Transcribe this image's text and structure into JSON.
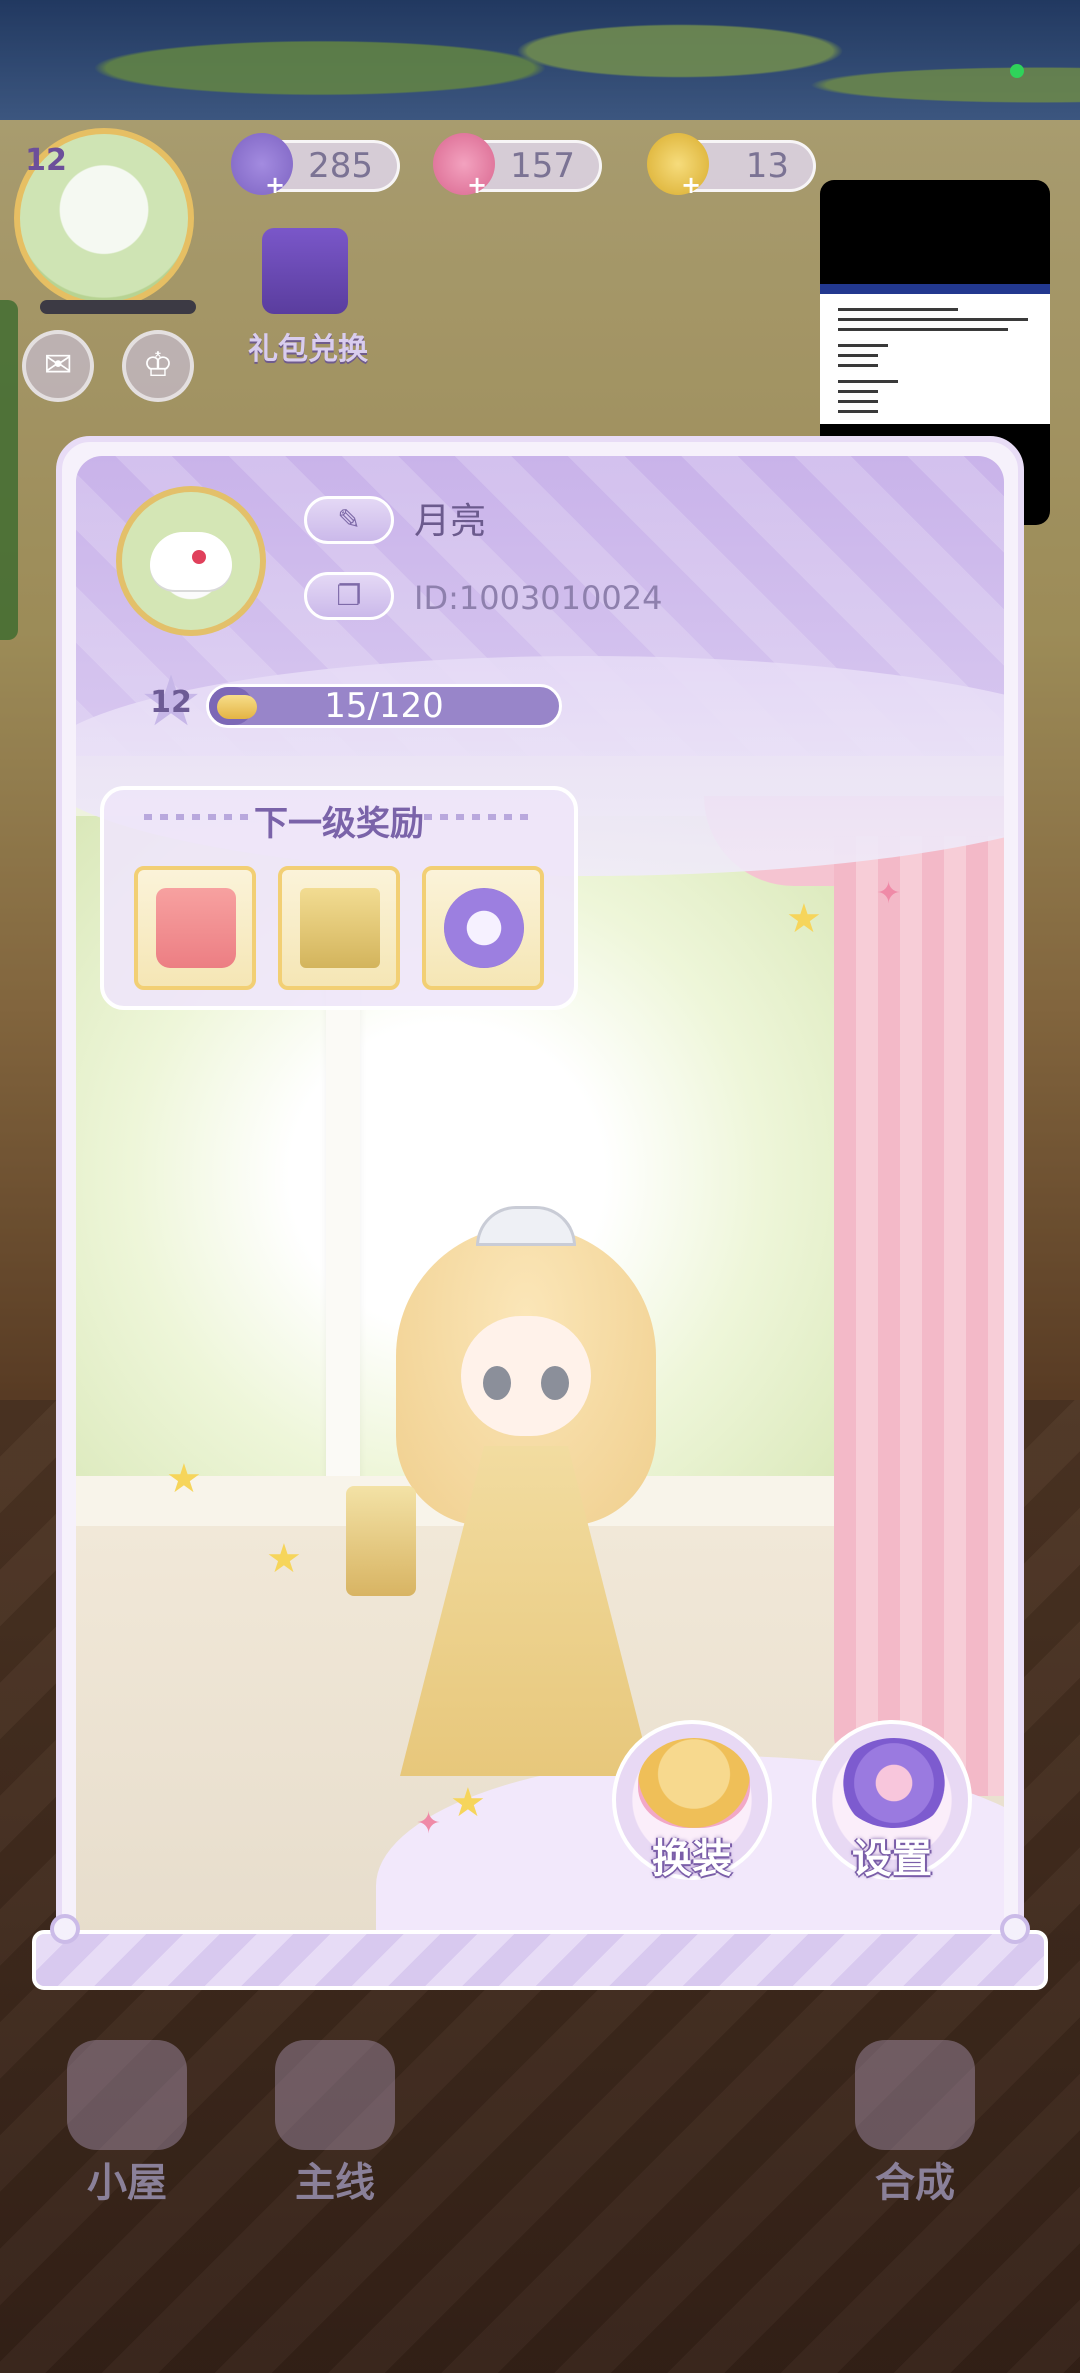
{
  "hud": {
    "player_level": "12",
    "energy": "285",
    "gems": "157",
    "coins": "13",
    "gift_label": "礼包兑换"
  },
  "profile": {
    "name": "月亮",
    "id_text": "ID:1003010024",
    "level": "12",
    "exp_text": "15/120",
    "exp_fraction": 0.125
  },
  "rewards": {
    "title": "下一级奖励",
    "items": [
      "bag-icon",
      "box-icon",
      "ring-icon"
    ]
  },
  "actions": {
    "dress_label": "换装",
    "settings_label": "设置"
  },
  "nav": {
    "house_label": "小屋",
    "story_label": "主线",
    "merge_label": "合成"
  },
  "colors": {
    "panel_purple": "#c9b3ea",
    "accent_gold": "#e3c06a",
    "exp_track": "#9885c9"
  }
}
